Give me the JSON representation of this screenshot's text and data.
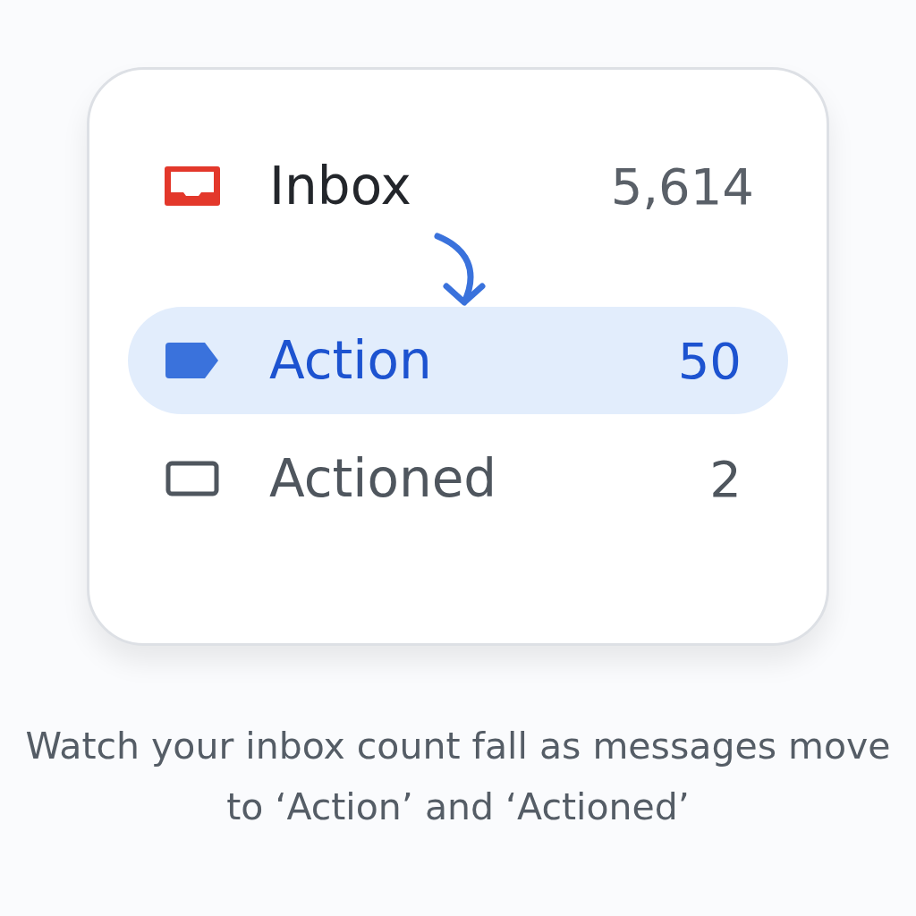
{
  "folders": [
    {
      "kind": "inbox",
      "name": "Inbox",
      "count": "5,614",
      "color": "#e3382b",
      "selected": false
    },
    {
      "kind": "label",
      "name": "Action",
      "count": "50",
      "color": "#3a72dc",
      "selected": true
    },
    {
      "kind": "outline",
      "name": "Actioned",
      "count": "2",
      "color": "#4f565e",
      "selected": false
    }
  ],
  "caption": "Watch your inbox count fall as messages move to ‘Action’ and ‘Actioned’"
}
